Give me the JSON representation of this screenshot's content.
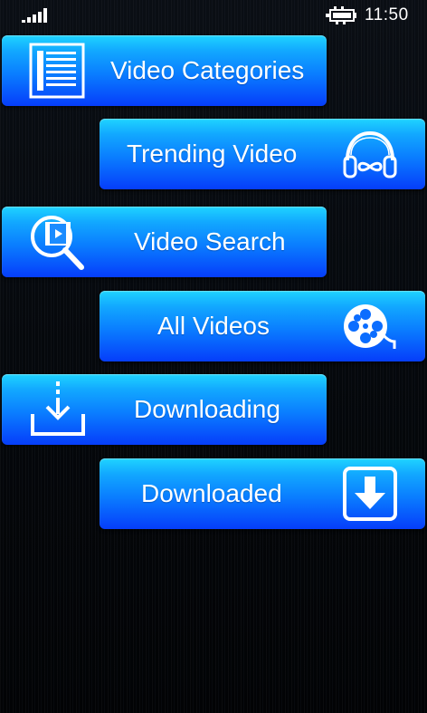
{
  "status_bar": {
    "time": "11:50",
    "signal_icon": "signal-strength-icon",
    "battery_icon": "battery-charging-icon"
  },
  "menu": [
    {
      "label": "Video Categories",
      "icon": "list-icon"
    },
    {
      "label": "Trending Video",
      "icon": "headphones-icon"
    },
    {
      "label": "Video Search",
      "icon": "video-search-icon"
    },
    {
      "label": "All Videos",
      "icon": "film-reel-icon"
    },
    {
      "label": "Downloading",
      "icon": "download-tray-icon"
    },
    {
      "label": "Downloaded",
      "icon": "download-box-icon"
    }
  ],
  "colors": {
    "button_top": "#1fd4ff",
    "button_bottom": "#063dfa",
    "background": "#040608",
    "text": "#ffffff"
  }
}
